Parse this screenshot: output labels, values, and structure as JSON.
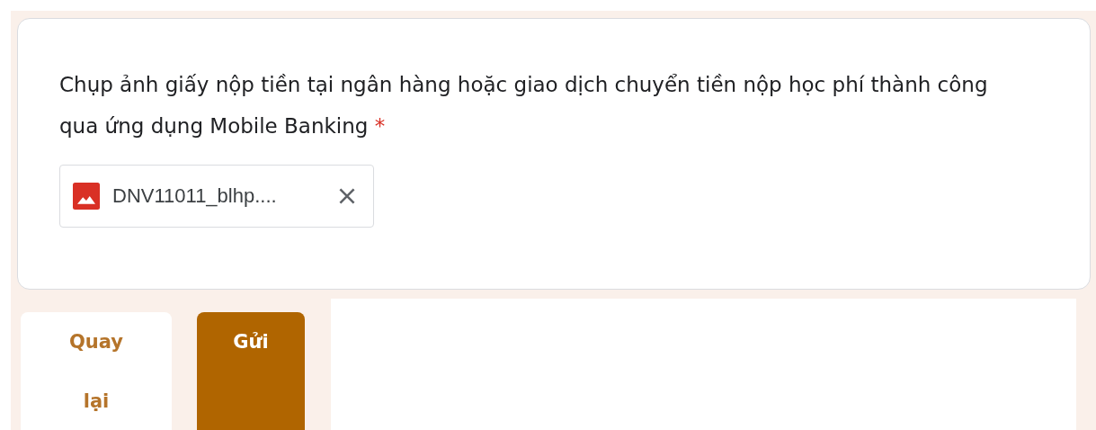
{
  "question": {
    "title": "Chụp ảnh giấy nộp tiền tại ngân hàng hoặc giao dịch chuyển tiền nộp học phí thành công qua ứng dụng Mobile Banking",
    "required_mark": "*",
    "file": {
      "name": "DNV11011_blhp...."
    }
  },
  "buttons": [
    {
      "label": "Quay lại",
      "kind": "secondary"
    },
    {
      "label": "Gửi",
      "kind": "primary"
    }
  ]
}
